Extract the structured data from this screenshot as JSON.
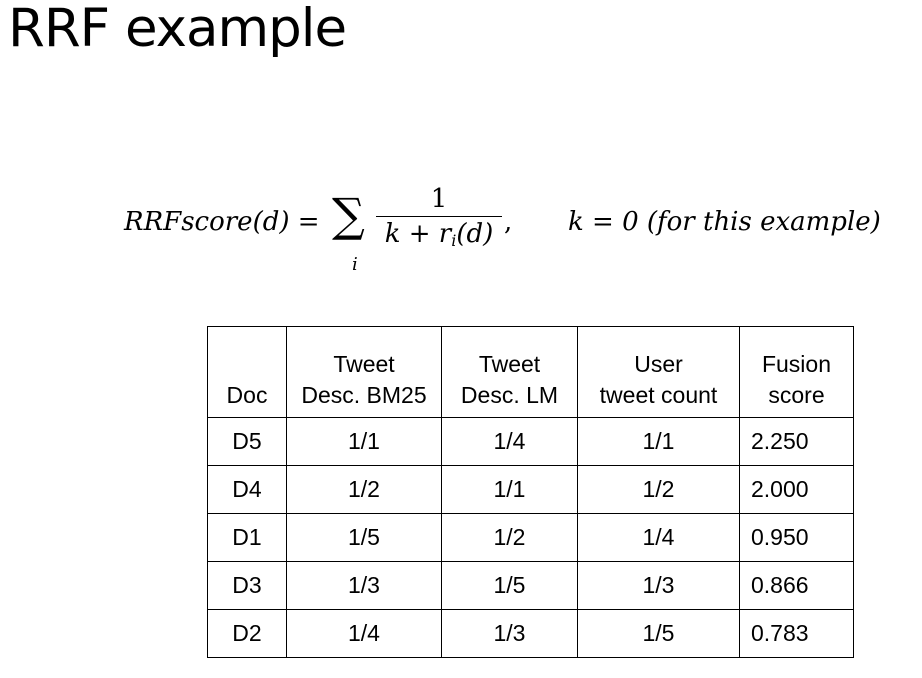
{
  "slide": {
    "title": "RRF example"
  },
  "formula": {
    "lhs": "RRFscore(d) =",
    "sigma": "∑",
    "sum_index": "i",
    "numerator": "1",
    "denominator_main": "k + r",
    "denominator_sub": "i",
    "denominator_tail": "(d)",
    "comma": ",",
    "condition": "k = 0 (for this example)"
  },
  "table": {
    "headers": [
      {
        "lines": [
          "Doc"
        ]
      },
      {
        "lines": [
          "Tweet",
          "Desc. BM25"
        ]
      },
      {
        "lines": [
          "Tweet",
          "Desc. LM"
        ]
      },
      {
        "lines": [
          "User",
          "tweet count"
        ]
      },
      {
        "lines": [
          "Fusion",
          "score"
        ]
      }
    ],
    "rows": [
      {
        "doc": "D5",
        "bm25": "1/1",
        "lm": "1/4",
        "count": "1/1",
        "fusion": "2.250",
        "bold": true
      },
      {
        "doc": "D4",
        "bm25": "1/2",
        "lm": "1/1",
        "count": "1/2",
        "fusion": "2.000",
        "bold": false
      },
      {
        "doc": "D1",
        "bm25": "1/5",
        "lm": "1/2",
        "count": "1/4",
        "fusion": "0.950",
        "bold": false
      },
      {
        "doc": "D3",
        "bm25": "1/3",
        "lm": "1/5",
        "count": "1/3",
        "fusion": "0.866",
        "bold": false
      },
      {
        "doc": "D2",
        "bm25": "1/4",
        "lm": "1/3",
        "count": "1/5",
        "fusion": "0.783",
        "bold": false
      }
    ]
  }
}
